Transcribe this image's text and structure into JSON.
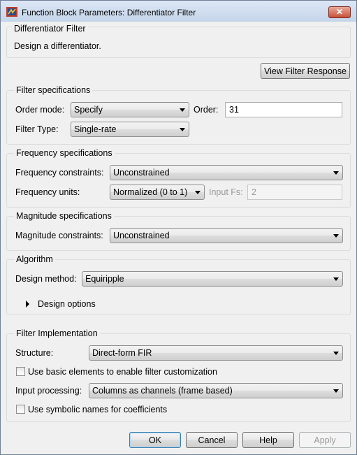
{
  "window": {
    "title": "Function Block Parameters: Differentiator Filter",
    "close_glyph": "✕"
  },
  "header": {
    "block_name": "Differentiator Filter",
    "description": "Design a differentiator."
  },
  "view_filter_response_label": "View Filter Response",
  "filter_specifications": {
    "title": "Filter specifications",
    "order_mode_label": "Order mode:",
    "order_mode_value": "Specify",
    "order_label": "Order:",
    "order_value": "31",
    "filter_type_label": "Filter Type:",
    "filter_type_value": "Single-rate"
  },
  "frequency_specifications": {
    "title": "Frequency specifications",
    "constraints_label": "Frequency constraints:",
    "constraints_value": "Unconstrained",
    "units_label": "Frequency units:",
    "units_value": "Normalized (0 to 1)",
    "input_fs_label": "Input Fs:",
    "input_fs_value": "2"
  },
  "magnitude_specifications": {
    "title": "Magnitude specifications",
    "constraints_label": "Magnitude constraints:",
    "constraints_value": "Unconstrained"
  },
  "algorithm": {
    "title": "Algorithm",
    "design_method_label": "Design method:",
    "design_method_value": "Equiripple",
    "design_options_label": "Design options"
  },
  "filter_implementation": {
    "title": "Filter Implementation",
    "structure_label": "Structure:",
    "structure_value": "Direct-form FIR",
    "basic_elements_label": "Use basic elements to enable filter customization",
    "input_processing_label": "Input processing:",
    "input_processing_value": "Columns as channels (frame based)",
    "symbolic_names_label": "Use symbolic names for coefficients"
  },
  "buttons": {
    "ok": "OK",
    "cancel": "Cancel",
    "help": "Help",
    "apply": "Apply"
  }
}
